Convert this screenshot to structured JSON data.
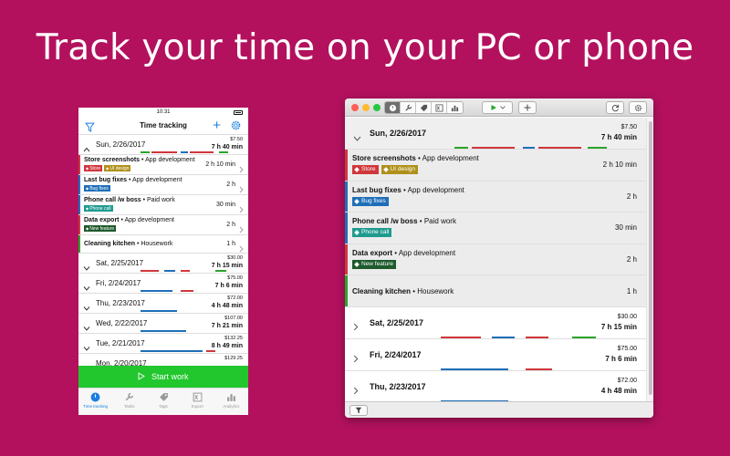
{
  "headline": "Track your time on your PC or phone",
  "colors": {
    "background": "#b3115e",
    "start_button": "#21c72d",
    "accent": "#1a7fe0",
    "red": "#d0373c",
    "blue": "#1f6fb8",
    "green": "#2aa42a"
  },
  "phone": {
    "status_time": "10:31",
    "nav_title": "Time tracking",
    "start_label": "Start work",
    "tabs": [
      {
        "label": "Time tracking",
        "icon": "clock-icon",
        "active": true
      },
      {
        "label": "Tasks",
        "icon": "wrench-icon",
        "active": false
      },
      {
        "label": "Tags",
        "icon": "tags-icon",
        "active": false
      },
      {
        "label": "Export",
        "icon": "excel-icon",
        "active": false
      },
      {
        "label": "Analytics",
        "icon": "chart-icon",
        "active": false
      }
    ],
    "expanded_day": {
      "date": "Sun, 2/26/2017",
      "money": "$7.50",
      "duration": "7 h 40 min",
      "entries": [
        {
          "task": "Store screenshots",
          "project": "App development",
          "duration": "2 h 10 min",
          "stripe": "#d0373c",
          "tags": [
            {
              "label": "Store",
              "color": "#d0373c"
            },
            {
              "label": "UI design",
              "color": "#b0901a"
            }
          ]
        },
        {
          "task": "Last bug fixes",
          "project": "App development",
          "duration": "2 h",
          "stripe": "#1f6fb8",
          "tags": [
            {
              "label": "Bug fixes",
              "color": "#1f6fb8"
            }
          ]
        },
        {
          "task": "Phone call /w boss",
          "project": "Paid work",
          "duration": "30 min",
          "stripe": "#1f6fb8",
          "tags": [
            {
              "label": "Phone call",
              "color": "#1f9a8f"
            }
          ]
        },
        {
          "task": "Data export",
          "project": "App development",
          "duration": "2 h",
          "stripe": "#d0373c",
          "tags": [
            {
              "label": "New feature",
              "color": "#1e5a2c"
            }
          ]
        },
        {
          "task": "Cleaning kitchen",
          "project": "Housework",
          "duration": "1 h",
          "stripe": "#2aa42a",
          "tags": []
        }
      ]
    },
    "days": [
      {
        "date": "Sat, 2/25/2017",
        "money": "$30.00",
        "duration": "7 h 15 min"
      },
      {
        "date": "Fri, 2/24/2017",
        "money": "$75.00",
        "duration": "7 h 6 min"
      },
      {
        "date": "Thu, 2/23/2017",
        "money": "$72.00",
        "duration": "4 h 48 min"
      },
      {
        "date": "Wed, 2/22/2017",
        "money": "$107.00",
        "duration": "7 h 21 min"
      },
      {
        "date": "Tue, 2/21/2017",
        "money": "$132.25",
        "duration": "8 h 49 min"
      },
      {
        "date": "Mon, 2/20/2017",
        "money": "$129.25",
        "duration": ""
      }
    ]
  },
  "window": {
    "expanded_day": {
      "date": "Sun, 2/26/2017",
      "money": "$7.50",
      "duration": "7 h 40 min"
    },
    "days": [
      {
        "date": "Sat, 2/25/2017",
        "money": "$30.00",
        "duration": "7 h 15 min"
      },
      {
        "date": "Fri, 2/24/2017",
        "money": "$75.00",
        "duration": "7 h 6 min"
      },
      {
        "date": "Thu, 2/23/2017",
        "money": "$72.00",
        "duration": "4 h 48 min"
      }
    ]
  }
}
